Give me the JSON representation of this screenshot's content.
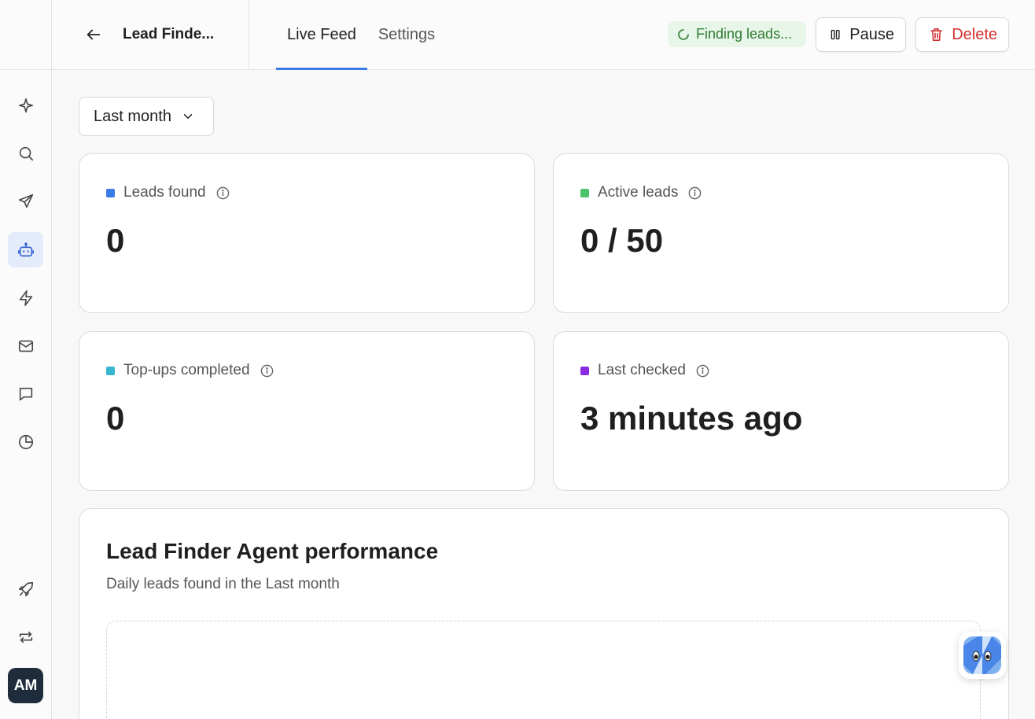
{
  "header": {
    "agent_title": "Lead Finde...",
    "tabs": [
      {
        "label": "Live Feed",
        "active": true
      },
      {
        "label": "Settings",
        "active": false
      }
    ],
    "status": "Finding leads...",
    "pause_label": "Pause",
    "delete_label": "Delete"
  },
  "sidebar": {
    "items": [
      {
        "icon": "sparkle-icon"
      },
      {
        "icon": "search-icon"
      },
      {
        "icon": "send-icon"
      },
      {
        "icon": "bot-icon",
        "active": true
      },
      {
        "icon": "lightning-icon"
      },
      {
        "icon": "mail-icon"
      },
      {
        "icon": "chat-icon"
      },
      {
        "icon": "pie-chart-icon"
      },
      {
        "icon": "rocket-icon"
      },
      {
        "icon": "repeat-icon"
      }
    ],
    "avatar": "AM"
  },
  "filter": {
    "selected": "Last month"
  },
  "stats": {
    "leads_found": {
      "label": "Leads found",
      "value": "0",
      "color": "#3b7be8"
    },
    "active_leads": {
      "label": "Active leads",
      "value": "0 / 50",
      "color": "#4cc26a"
    },
    "topups": {
      "label": "Top-ups completed",
      "value": "0",
      "color": "#38b5cf"
    },
    "last_checked": {
      "label": "Last checked",
      "value": "3 minutes ago",
      "color": "#8a2be2"
    }
  },
  "performance": {
    "title": "Lead Finder Agent performance",
    "subtitle": "Daily leads found in the Last month"
  },
  "colors": {
    "accent": "#3b7be8",
    "status_bg": "#e8f5e9",
    "status_text": "#2e7d32",
    "danger": "#d32f2f"
  }
}
